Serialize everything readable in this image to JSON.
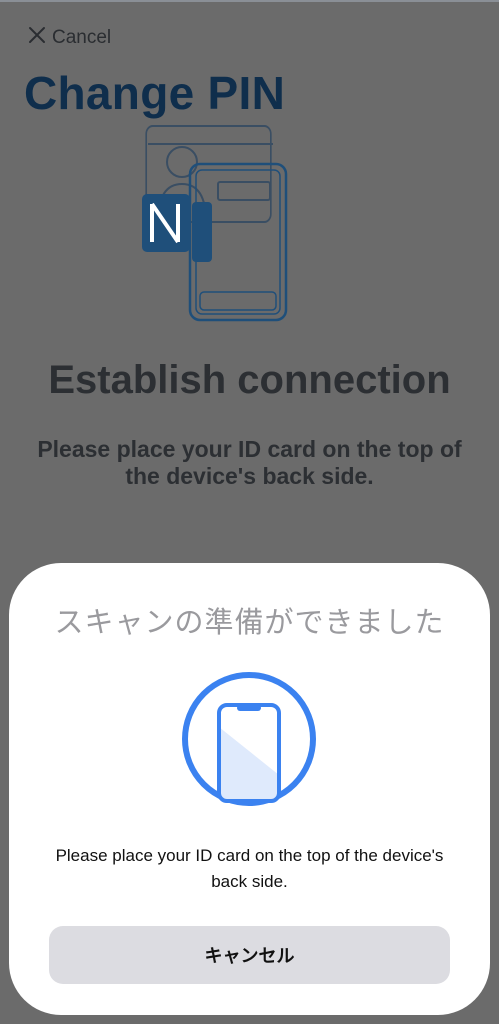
{
  "header": {
    "cancel_label": "Cancel",
    "title": "Change PIN"
  },
  "content": {
    "heading": "Establish connection",
    "description": "Please place your ID card on the top of the device's back side."
  },
  "nfc_sheet": {
    "title": "スキャンの準備ができました",
    "message": "Please place your ID card on the top of the device's back side.",
    "cancel_label": "キャンセル"
  },
  "colors": {
    "accent": "#3b82f0",
    "title": "#0f2e4c",
    "nfc_badge": "#1f4f7a"
  },
  "icons": {
    "close": "close-icon",
    "illustration": "id-card-nfc-illustration",
    "scan": "phone-scan-icon"
  }
}
